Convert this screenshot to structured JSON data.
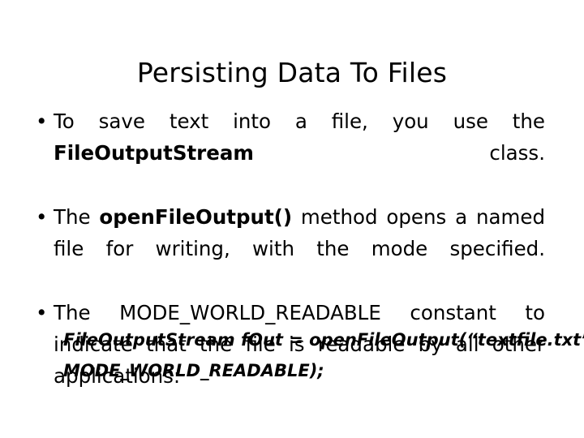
{
  "slide": {
    "title": "Persisting Data To Files",
    "bullets": [
      {
        "marker": "•",
        "segments": [
          {
            "text": "To save text into a file, you use the ",
            "bold": false
          },
          {
            "text": "FileOutputStream",
            "bold": true
          },
          {
            "text": " class.",
            "bold": false
          }
        ]
      },
      {
        "marker": "•",
        "segments": [
          {
            "text": "The ",
            "bold": false
          },
          {
            "text": "openFileOutput()",
            "bold": true
          },
          {
            "text": " method opens a named file for writing, with the mode specified.",
            "bold": false
          }
        ]
      },
      {
        "marker": "•",
        "segments": [
          {
            "text": "The MODE_WORLD_READABLE constant to indicate that the file is readable by all other applications:",
            "bold": false
          }
        ]
      }
    ],
    "code_lines": [
      "FileOutputStream fOut = openFileOutput(“textfile.txt”,",
      "MODE_WORLD_READABLE);"
    ]
  },
  "colors": {
    "background": "#ffffff",
    "text": "#000000"
  }
}
